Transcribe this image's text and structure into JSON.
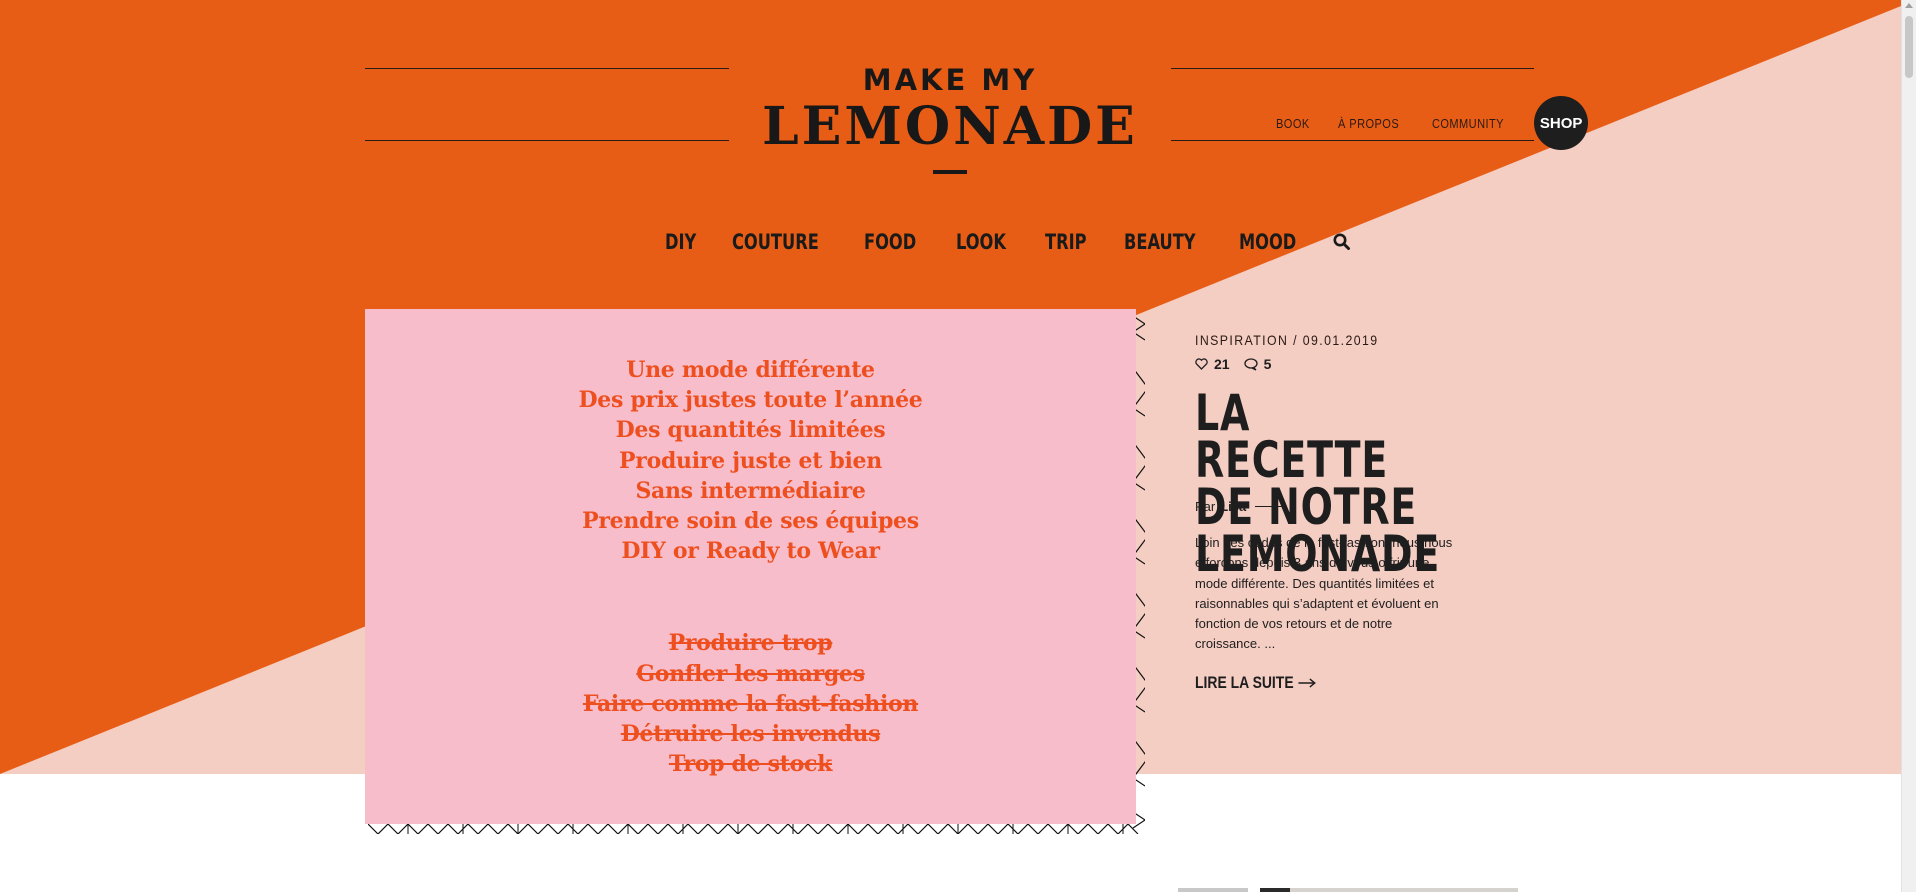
{
  "colors": {
    "orange": "#e85d15",
    "blush": "#f4cdc3",
    "pink_panel": "#f8bdcb",
    "manifesto_text": "#ee4f1e",
    "ink": "#1e1e1e"
  },
  "logo": {
    "line1": "MAKE MY",
    "line2": "LEMONADE"
  },
  "top_nav": {
    "book": "BOOK",
    "apropos": "À PROPOS",
    "community": "COMMUNITY",
    "shop": "SHOP"
  },
  "category_nav": {
    "items": [
      "DIY",
      "COUTURE",
      "FOOD",
      "LOOK",
      "TRIP",
      "BEAUTY",
      "MOOD"
    ],
    "search_icon": "search-icon"
  },
  "manifesto": {
    "positives": [
      "Une mode différente",
      "Des prix justes toute l’année",
      "Des quantités limitées",
      "Produire juste et bien",
      "Sans intermédiaire",
      "Prendre soin de ses équipes",
      "DIY or Ready to Wear"
    ],
    "negatives": [
      "Produire trop",
      "Gonfler les marges",
      "Faire comme la fast-fashion",
      "Détruire les invendus",
      "Trop de stock"
    ]
  },
  "article": {
    "meta": "INSPIRATION / 09.01.2019",
    "likes": "21",
    "comments": "5",
    "title": "LA RECETTE DE NOTRE LEMONADE",
    "by_prefix": "Par",
    "author": "Lisa",
    "excerpt": "Loin des codes de la fast-fashion, nous nous efforçons depuis 3 ans de vous offrir une mode différente. Des quantités limitées et raisonnables qui s’adaptent et évoluent en fonction de vos retours et de notre croissance. ...",
    "read_more": "LIRE LA SUITE"
  }
}
